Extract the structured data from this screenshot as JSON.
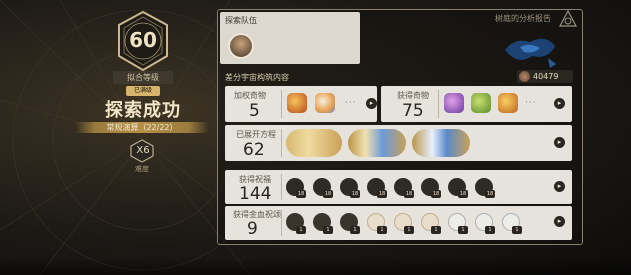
{
  "level": {
    "value": "60",
    "label": "拟合等级",
    "cleared_tag": "已满级"
  },
  "result": {
    "title": "探索成功",
    "mode": "常规演算（22/22）",
    "difficulty_value": "X6",
    "difficulty_label": "难度"
  },
  "team": {
    "title": "探索队伍"
  },
  "header": {
    "report_link": "树庭的分析报告"
  },
  "section": {
    "title": "差分宇宙构筑内容",
    "score": "40479"
  },
  "stats": {
    "weighted_curios": {
      "label": "加权奇物",
      "value": "5",
      "more": "···"
    },
    "obtained_curios": {
      "label": "获得奇物",
      "value": "75",
      "more": "···"
    },
    "equations": {
      "label": "已展开方程",
      "value": "62"
    },
    "blessings": {
      "label": "获得祝福",
      "value": "144",
      "badges": [
        "18",
        "18",
        "18",
        "18",
        "18",
        "18",
        "18",
        "18"
      ]
    },
    "golden_blessings": {
      "label": "获得金血祝颂",
      "value": "9",
      "badges": [
        "1",
        "1",
        "1",
        "1",
        "1",
        "1",
        "1",
        "1",
        "1"
      ]
    }
  },
  "colors": {
    "gold": "#d7b46c",
    "panel_card": "#e6e3dc",
    "dark_button": "#2a2620",
    "blue_accent": "#2a5a9a"
  },
  "icons": {
    "arrow": "▸",
    "difficulty": "hexagon-icon",
    "report": "triangle-emblem-icon"
  }
}
